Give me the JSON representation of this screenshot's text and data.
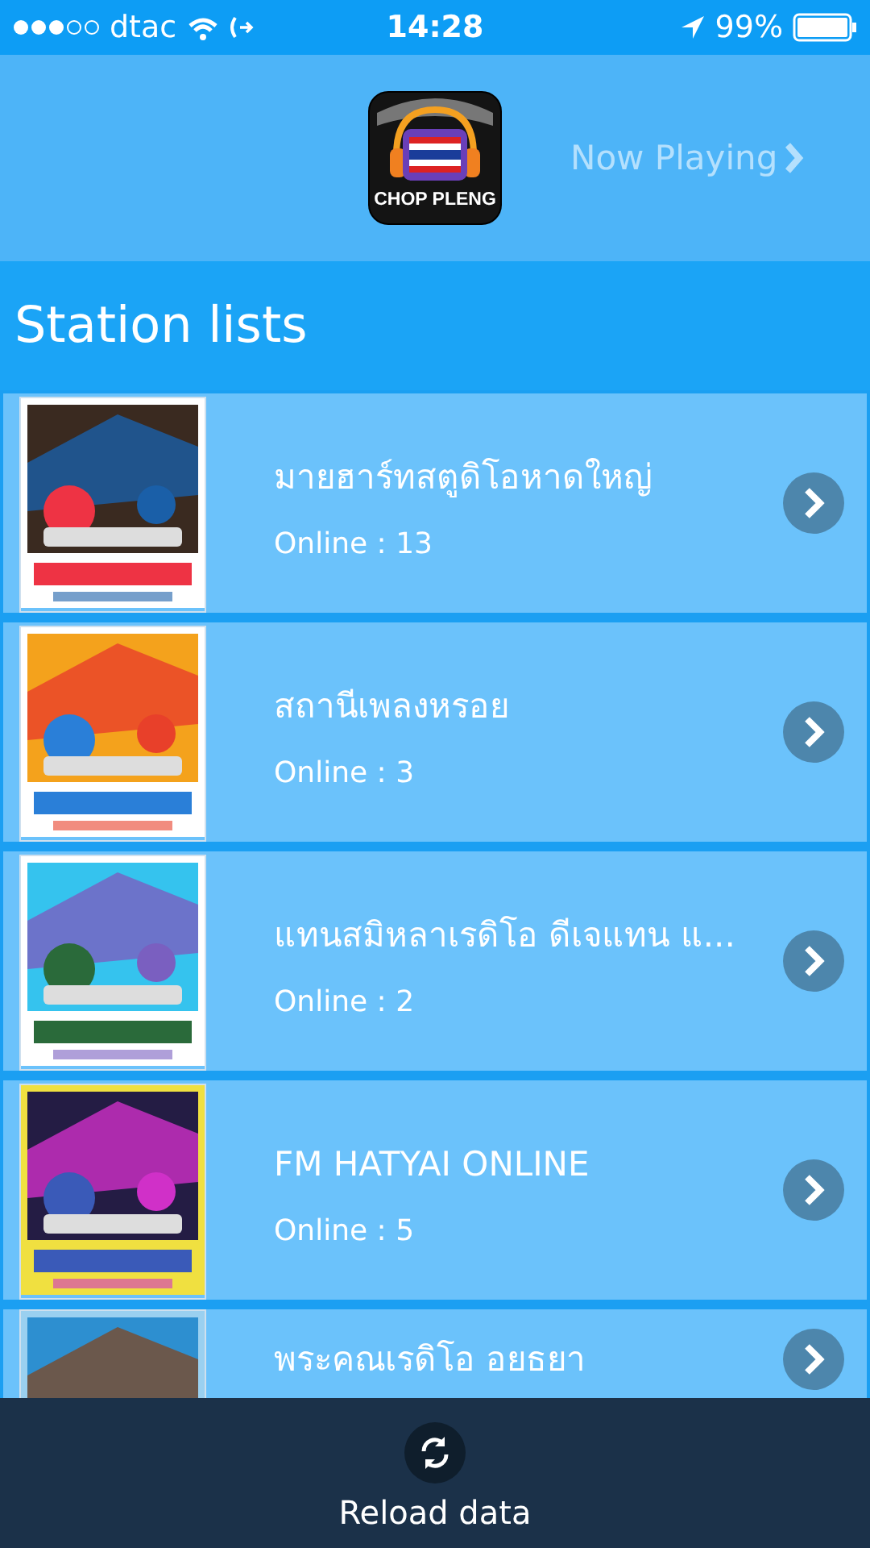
{
  "status_bar": {
    "carrier": "dtac",
    "time": "14:28",
    "battery": "99%"
  },
  "header": {
    "logo_text": "CHOP PLENG",
    "now_playing": "Now Playing",
    "now_playing_disabled": true
  },
  "section_title": "Station lists",
  "stations": [
    {
      "name": "มายฮาร์ทสตูดิโอหาดใหญ่",
      "online": "Online : 13"
    },
    {
      "name": "สถานีเพลงหรอย",
      "online": "Online : 3"
    },
    {
      "name": "แทนสมิหลาเรดิโอ ดีเจแทน แ...",
      "online": "Online : 2"
    },
    {
      "name": "FM HATYAI ONLINE",
      "online": "Online : 5"
    },
    {
      "name": "พระคณเรดิโอ อยธยา"
    }
  ],
  "bottom_bar": {
    "label": "Reload data"
  }
}
